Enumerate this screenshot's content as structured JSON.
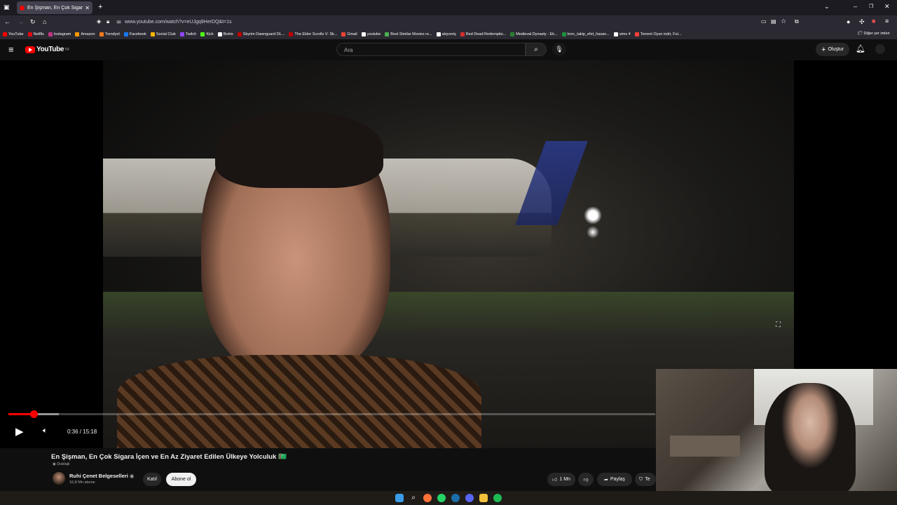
{
  "browser": {
    "tab_title": "En Şişman, En Çok Sigara İçen ve En Az Ziyaret Edilen Ülkeye Yolculuk",
    "url": "www.youtube.com/watch?v=eUJgq9HerDQ&t=1s",
    "bookmarks": [
      "YouTube",
      "Netflix",
      "Instagram",
      "Amazon",
      "Trendyol",
      "Facebook",
      "Social Club",
      "Twitch",
      "Kick",
      "Botrix",
      "Skyrim Dawnguard DL...",
      "The Elder Scrolls V: Sk...",
      "Gmail",
      "youtube",
      "Best Similar Movies re...",
      "alışveriş",
      "Red Dead Redemptio...",
      "Medieval Dynasty - Ek...",
      "borc_takip_efet_hasan...",
      "sims 4",
      "Torrent Oyun indir, Ful..."
    ],
    "other_bookmarks": "Diğer yer imleri",
    "bookmark_colors": [
      "#ff0000",
      "#e50914",
      "#c13584",
      "#ff9900",
      "#f27a1a",
      "#1877f2",
      "#f7b500",
      "#9146ff",
      "#53fc18",
      "#ffffff",
      "#c00000",
      "#c00000",
      "#ea4335",
      "#ffffff",
      "#4caf50",
      "#ffffff",
      "#d32f2f",
      "#2e7d32",
      "#1e8e3e",
      "#ffffff",
      "#f44336"
    ]
  },
  "youtube": {
    "logo": "YouTube",
    "logo_sup": "TR",
    "search_placeholder": "Ara",
    "create_label": "Oluştur"
  },
  "player": {
    "time": "0:36 / 15:18",
    "progress_fraction": 0.0392,
    "buffered_fraction": 0.078
  },
  "video": {
    "title": "En Şişman, En Çok Sigara İçen ve En Az Ziyaret Edilen Ülkeye Yolculuk 🇹🇲",
    "dubbed": "Dublajlı",
    "channel": "Ruhi Çenet Belgeselleri",
    "subscribers": "16,8 Mn abone",
    "join_label": "Katıl",
    "subscribe_label": "Abone ol",
    "likes": "1 Mn",
    "share_label": "Paylaş",
    "thanks_label": "Te"
  }
}
